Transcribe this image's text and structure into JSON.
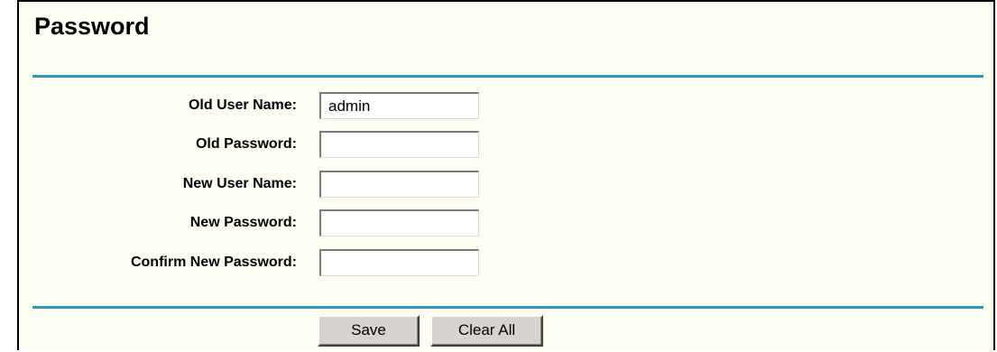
{
  "page": {
    "title": "Password"
  },
  "form": {
    "fields": [
      {
        "label": "Old User Name:",
        "value": "admin",
        "type": "text"
      },
      {
        "label": "Old Password:",
        "value": "",
        "type": "password"
      },
      {
        "label": "New User Name:",
        "value": "",
        "type": "text"
      },
      {
        "label": "New Password:",
        "value": "",
        "type": "password"
      },
      {
        "label": "Confirm New Password:",
        "value": "",
        "type": "password"
      }
    ]
  },
  "actions": {
    "save_label": "Save",
    "clear_label": "Clear All"
  },
  "colors": {
    "panel_background": "#fefef2",
    "divider": "#2f93c6",
    "button_face": "#d6d3ce"
  }
}
